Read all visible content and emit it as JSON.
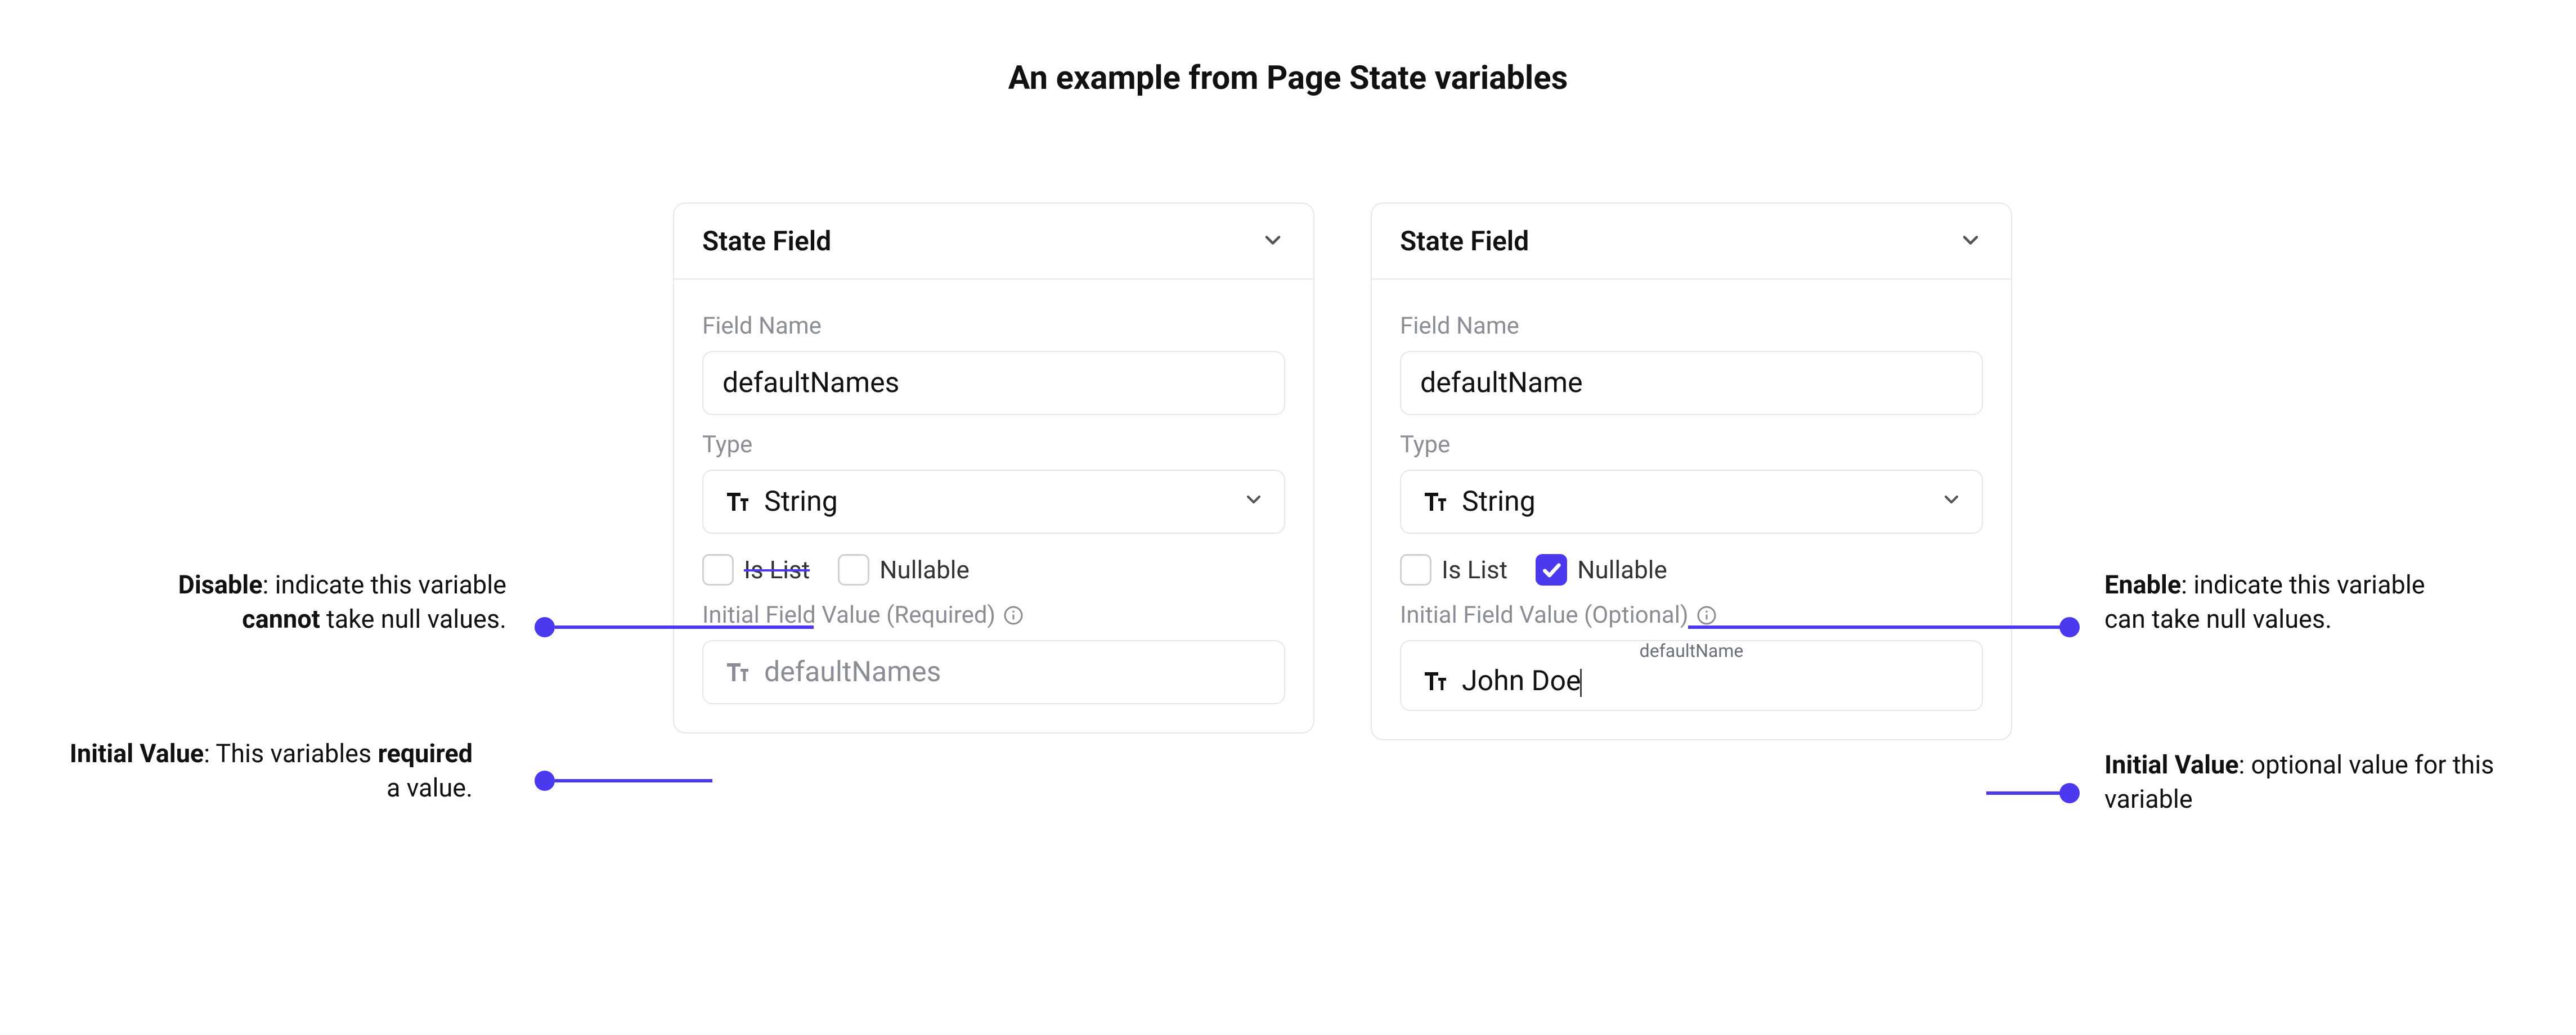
{
  "title": "An example from Page State variables",
  "leftCard": {
    "header": "State Field",
    "fieldNameLabel": "Field Name",
    "fieldNameValue": "defaultNames",
    "typeLabel": "Type",
    "typeValue": "String",
    "isListLabel": "Is List",
    "isListChecked": false,
    "nullableLabel": "Nullable",
    "nullableChecked": false,
    "initialLabel": "Initial Field Value (Required)",
    "initialPlaceholder": "defaultNames"
  },
  "rightCard": {
    "header": "State Field",
    "fieldNameLabel": "Field Name",
    "fieldNameValue": "defaultName",
    "typeLabel": "Type",
    "typeValue": "String",
    "isListLabel": "Is List",
    "isListChecked": false,
    "nullableLabel": "Nullable",
    "nullableChecked": true,
    "initialLabel": "Initial Field Value (Optional)",
    "initialFloating": "defaultName",
    "initialValue": "John Doe"
  },
  "anno": {
    "disableTitle": "Disable",
    "disableRest": ": indicate this variable ",
    "disableBold": "cannot",
    "disableTail": " take null values.",
    "ivLeftTitle": "Initial Value",
    "ivLeftRest": ": This variables ",
    "ivLeftBold": "required",
    "ivLeftTail": " a value.",
    "enableTitle": "Enable",
    "enableRest": ": indicate this variable can take null values.",
    "ivRightTitle": "Initial Value",
    "ivRightRest": ": optional value for this variable"
  }
}
